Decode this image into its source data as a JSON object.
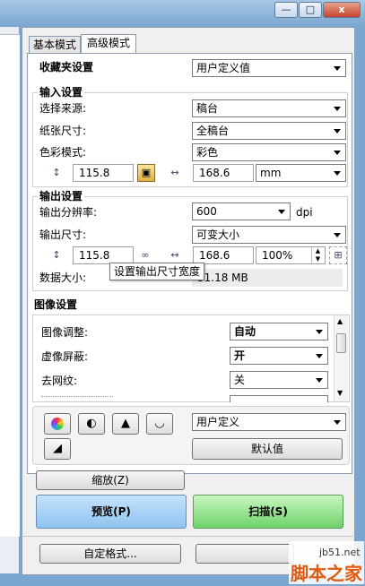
{
  "window": {
    "minimize_icon": "minimize-icon",
    "maximize_icon": "maximize-icon",
    "close_label": "x"
  },
  "tabs": [
    {
      "label": "基本模式",
      "active": false
    },
    {
      "label": "高级模式",
      "active": true
    }
  ],
  "favorites": {
    "label": "收藏夹设置",
    "value": "用户定义值"
  },
  "input_settings": {
    "title": "输入设置",
    "source_label": "选择来源:",
    "source_value": "稿台",
    "paper_label": "纸张尺寸:",
    "paper_value": "全稿台",
    "color_label": "色彩模式:",
    "color_value": "彩色",
    "width": "115.8",
    "height": "168.6",
    "unit": "mm"
  },
  "output_settings": {
    "title": "输出设置",
    "resolution_label": "输出分辨率:",
    "resolution_value": "600",
    "resolution_unit": "dpi",
    "size_label": "输出尺寸:",
    "size_value": "可变大小",
    "width": "115.8",
    "height": "168.6",
    "scale": "100%",
    "data_size_label": "数据大小:",
    "data_size_value": "51.18 MB",
    "tooltip": "设置输出尺寸宽度"
  },
  "image_settings": {
    "title": "图像设置",
    "rows": [
      {
        "label": "图像调整:",
        "value": "自动",
        "bold": true
      },
      {
        "label": "虚像屏蔽:",
        "value": "开",
        "bold": true
      },
      {
        "label": "去网纹:",
        "value": "关",
        "bold": false
      },
      {
        "label": "",
        "value": "",
        "bold": false
      }
    ]
  },
  "tools": {
    "preset_value": "用户定义",
    "default_label": "默认值"
  },
  "buttons": {
    "zoom": "缩放(Z)",
    "preview": "预览(P)",
    "scan": "扫描(S)",
    "custom_format": "自定格式..."
  },
  "watermark": {
    "site": "jb51.net",
    "brand": "脚本之家"
  }
}
